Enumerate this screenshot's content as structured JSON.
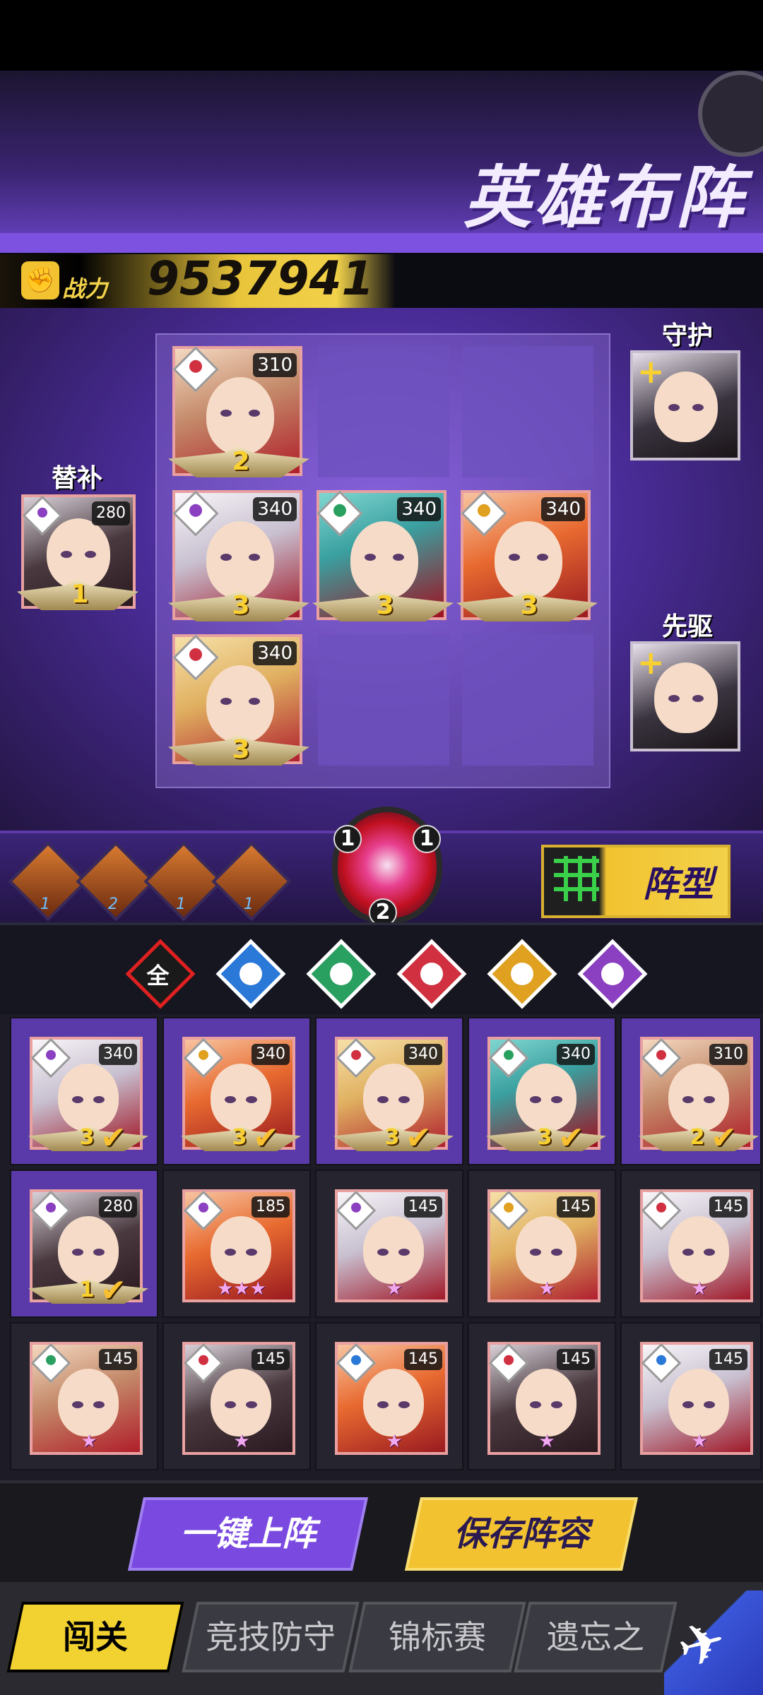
{
  "header": {
    "title": "英雄布阵"
  },
  "power": {
    "label": "战力",
    "value": "9537941"
  },
  "formation": {
    "guard_label": "守护",
    "vanguard_label": "先驱",
    "substitute_label": "替补",
    "formation_button_label": "阵型",
    "substitute": {
      "level": "280",
      "star": "1"
    },
    "grid": [
      {
        "row": 0,
        "col": 0,
        "level": "310",
        "star": "2",
        "faction": "red"
      },
      {
        "row": 1,
        "col": 0,
        "level": "340",
        "star": "3",
        "faction": "purple"
      },
      {
        "row": 1,
        "col": 1,
        "level": "340",
        "star": "3",
        "faction": "green"
      },
      {
        "row": 1,
        "col": 2,
        "level": "340",
        "star": "3",
        "faction": "gold"
      },
      {
        "row": 2,
        "col": 0,
        "level": "340",
        "star": "3",
        "faction": "red"
      }
    ],
    "shield_counts": {
      "left": "1",
      "right": "1",
      "bottom": "2"
    },
    "buffs": [
      {
        "name": "buff-1",
        "level": "1"
      },
      {
        "name": "buff-2",
        "level": "2"
      },
      {
        "name": "buff-3",
        "level": "1"
      },
      {
        "name": "buff-4",
        "level": "1"
      }
    ]
  },
  "filters": [
    {
      "name": "all",
      "label": "全",
      "color": "#e02020"
    },
    {
      "name": "blue",
      "color": "#2a78d8"
    },
    {
      "name": "green",
      "color": "#2aa060"
    },
    {
      "name": "red",
      "color": "#d03040"
    },
    {
      "name": "gold",
      "color": "#e0a020"
    },
    {
      "name": "purple",
      "color": "#8a40c0"
    }
  ],
  "hero_list": [
    {
      "level": "340",
      "star": "3",
      "selected": true
    },
    {
      "level": "340",
      "star": "3",
      "selected": true
    },
    {
      "level": "340",
      "star": "3",
      "selected": true
    },
    {
      "level": "340",
      "star": "3",
      "selected": true
    },
    {
      "level": "310",
      "star": "2",
      "selected": true
    },
    {
      "level": "280",
      "star": "1",
      "selected": true
    },
    {
      "level": "185",
      "stars": "★★★"
    },
    {
      "level": "145",
      "stars": "★"
    },
    {
      "level": "145",
      "stars": "★"
    },
    {
      "level": "145",
      "stars": "★"
    },
    {
      "level": "145",
      "stars": "★"
    },
    {
      "level": "145",
      "stars": "★"
    },
    {
      "level": "145",
      "stars": "★"
    },
    {
      "level": "145",
      "stars": "★"
    },
    {
      "level": "145",
      "stars": "★"
    }
  ],
  "actions": {
    "auto_deploy": "一键上阵",
    "save": "保存阵容"
  },
  "tabs": [
    "闯关",
    "竞技防守",
    "锦标赛",
    "遗忘之"
  ]
}
